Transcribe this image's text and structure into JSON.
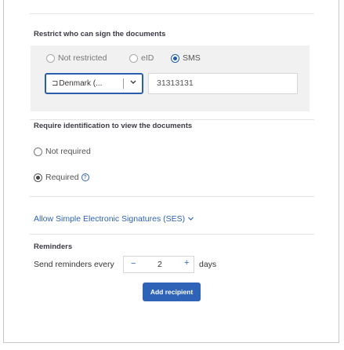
{
  "restrict": {
    "title": "Restrict who can sign the documents",
    "options": [
      {
        "label": "Not restricted",
        "selected": false
      },
      {
        "label": "eID",
        "selected": false
      },
      {
        "label": "SMS",
        "selected": true
      }
    ],
    "country_select": {
      "flag": "⊐",
      "value": "Denmark (..."
    },
    "phone_value": "31313131"
  },
  "identification": {
    "title": "Require identification to view the documents",
    "options": [
      {
        "label": "Not required",
        "selected": false
      },
      {
        "label": "Required",
        "selected": true
      }
    ],
    "help_glyph": "?"
  },
  "ses_link": {
    "label": "Allow Simple Electronic Signatures (SES)",
    "chevron": "﹀"
  },
  "reminders": {
    "title": "Reminders",
    "prefix": "Send reminders every",
    "minus": "−",
    "value": "2",
    "plus": "+",
    "suffix": "days"
  },
  "add_recipient_label": "Add recipient",
  "colors": {
    "accent": "#2e63b8",
    "panel": "#f1f1f1"
  }
}
